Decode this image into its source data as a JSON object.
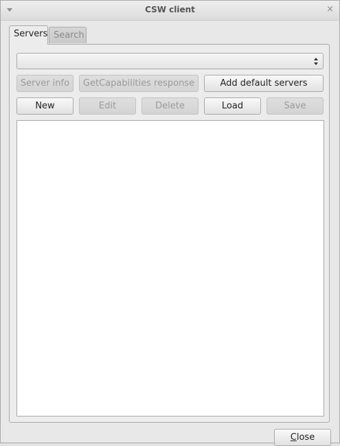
{
  "window": {
    "title": "CSW client",
    "menu_icon": "menu-arrow-icon",
    "close_icon_glyph": "×"
  },
  "tabs": [
    {
      "label": "Servers",
      "active": true
    },
    {
      "label": "Search",
      "active": false
    }
  ],
  "server_combo": {
    "value": ""
  },
  "buttons_row1": [
    {
      "label": "Server info",
      "enabled": false
    },
    {
      "label": "GetCapabilities response",
      "enabled": false
    },
    {
      "label": "Add default servers",
      "enabled": true
    }
  ],
  "buttons_row2": [
    {
      "label": "New",
      "enabled": true
    },
    {
      "label": "Edit",
      "enabled": false
    },
    {
      "label": "Delete",
      "enabled": false
    },
    {
      "label": "Load",
      "enabled": true
    },
    {
      "label": "Save",
      "enabled": false
    }
  ],
  "footer": {
    "close_label_mnemonic": "C",
    "close_label_rest": "lose"
  }
}
